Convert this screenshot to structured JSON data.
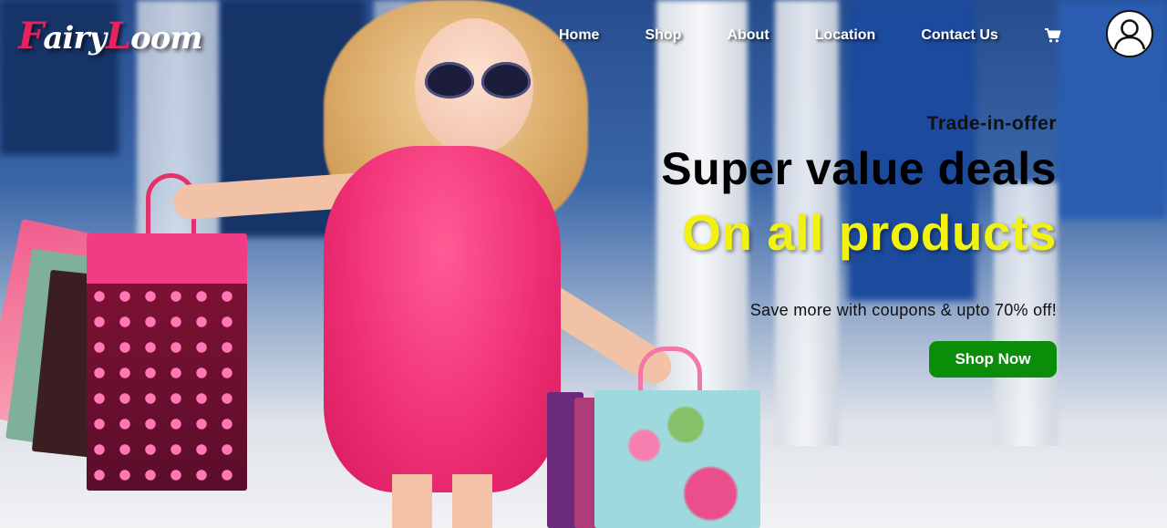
{
  "brand": {
    "logo_initial_1": "F",
    "logo_part_1": "airy",
    "logo_initial_2": "L",
    "logo_part_2": "oom"
  },
  "nav": {
    "items": [
      {
        "label": "Home"
      },
      {
        "label": "Shop"
      },
      {
        "label": "About"
      },
      {
        "label": "Location"
      },
      {
        "label": "Contact Us"
      }
    ],
    "cart_icon": "shopping-cart-icon",
    "account_icon": "user-avatar-icon"
  },
  "hero": {
    "eyebrow": "Trade-in-offer",
    "headline": "Super value deals",
    "highlight": "On all products",
    "subtext": "Save more with coupons & upto 70% off!",
    "cta_label": "Shop Now"
  },
  "colors": {
    "brand_accent": "#e8215f",
    "highlight": "#f1f20f",
    "cta": "#0a8e0a"
  }
}
